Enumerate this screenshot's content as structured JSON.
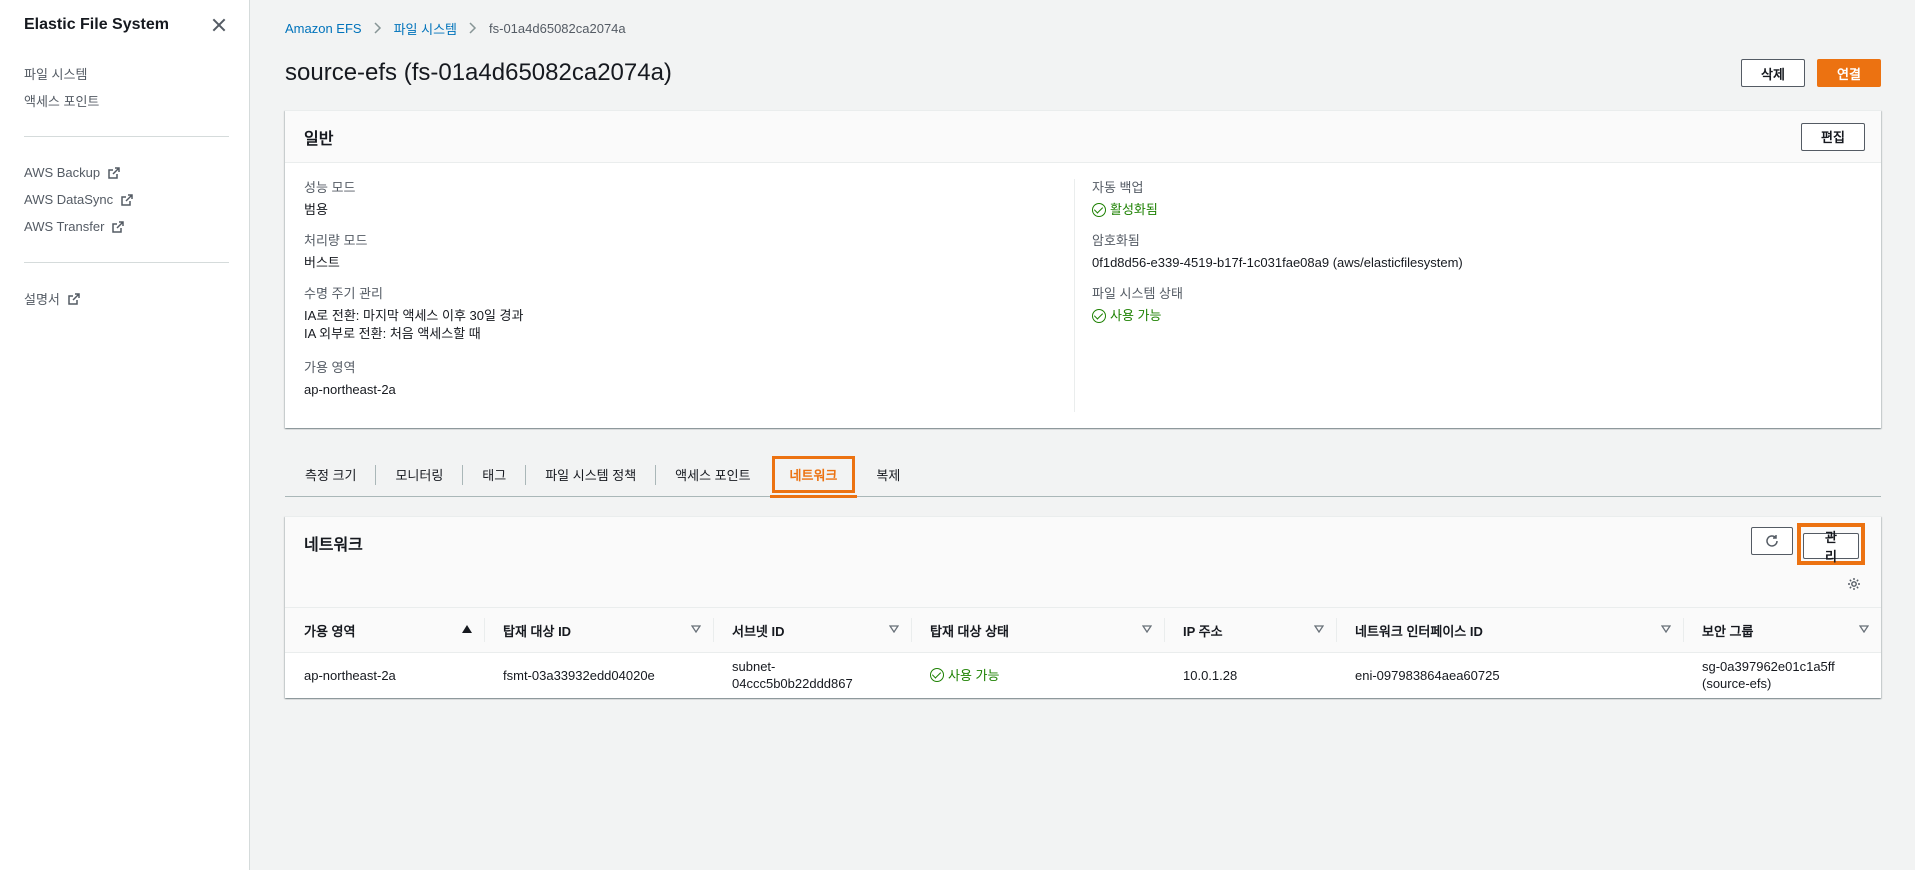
{
  "sidebar": {
    "title": "Elastic File System",
    "main_items": [
      "파일 시스템",
      "액세스 포인트"
    ],
    "external_items": [
      "AWS Backup",
      "AWS DataSync",
      "AWS Transfer"
    ],
    "doc_item": "설명서"
  },
  "breadcrumb": {
    "root": "Amazon EFS",
    "parent": "파일 시스템",
    "current": "fs-01a4d65082ca2074a"
  },
  "page": {
    "title": "source-efs (fs-01a4d65082ca2074a)",
    "delete_label": "삭제",
    "attach_label": "연결"
  },
  "general": {
    "title": "일반",
    "edit_label": "편집",
    "left": {
      "perf_mode_label": "성능 모드",
      "perf_mode_value": "범용",
      "throughput_label": "처리량 모드",
      "throughput_value": "버스트",
      "lifecycle_label": "수명 주기 관리",
      "lifecycle_value_1": "IA로 전환: 마지막 액세스 이후 30일 경과",
      "lifecycle_value_2": "IA 외부로 전환: 처음 액세스할 때",
      "az_label": "가용 영역",
      "az_value": "ap-northeast-2a"
    },
    "right": {
      "backup_label": "자동 백업",
      "backup_value": "활성화됨",
      "encryption_label": "암호화됨",
      "encryption_value": "0f1d8d56-e339-4519-b17f-1c031fae08a9 (aws/elasticfilesystem)",
      "state_label": "파일 시스템 상태",
      "state_value": "사용 가능"
    }
  },
  "tabs": [
    "측정 크기",
    "모니터링",
    "태그",
    "파일 시스템 정책",
    "액세스 포인트",
    "네트워크",
    "복제"
  ],
  "active_tab": "네트워크",
  "network": {
    "title": "네트워크",
    "manage_label": "관리",
    "columns": [
      "가용 영역",
      "탑재 대상 ID",
      "서브넷 ID",
      "탑재 대상 상태",
      "IP 주소",
      "네트워크 인터페이스 ID",
      "보안 그룹"
    ],
    "row": {
      "az": "ap-northeast-2a",
      "mount_target_id": "fsmt-03a33932edd04020e",
      "subnet_1": "subnet-",
      "subnet_2": "04ccc5b0b22ddd867",
      "state": "사용 가능",
      "ip": "10.0.1.28",
      "eni": "eni-097983864aea60725",
      "sg_1": "sg-0a397962e01c1a5ff",
      "sg_2": "(source-efs)"
    }
  },
  "colors": {
    "accent": "#ec7211",
    "link": "#0073bb",
    "success": "#1d8102"
  }
}
